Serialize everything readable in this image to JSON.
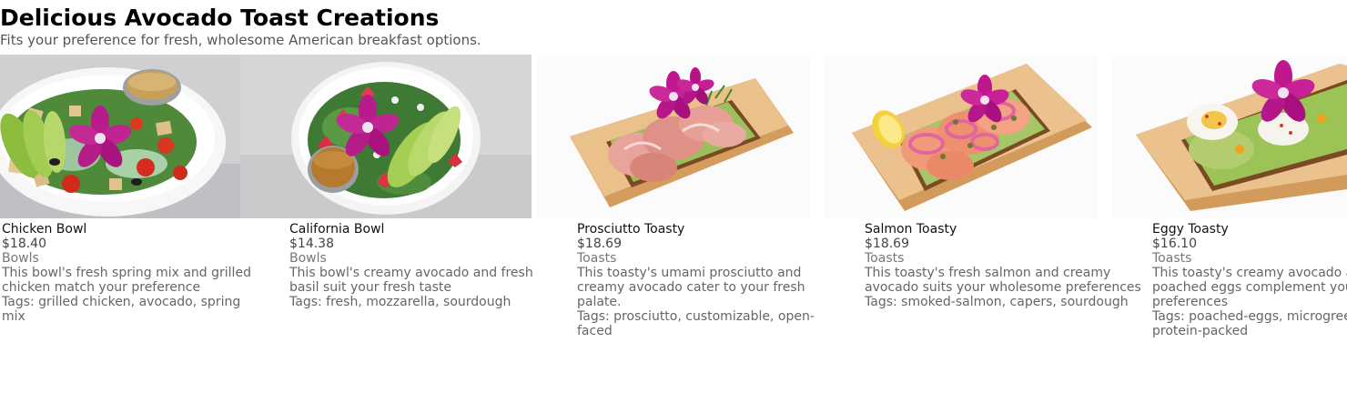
{
  "header": {
    "title": "Delicious Avocado Toast Creations",
    "subtitle": "Fits your preference for fresh, wholesome American breakfast options."
  },
  "items": [
    {
      "name": "Chicken Bowl",
      "price": "$18.40",
      "category": "Bowls",
      "description": "This bowl's fresh spring mix and grilled chicken match your preference",
      "tags": "Tags: grilled chicken, avocado, spring mix",
      "image": "salad-bowl-chicken-avocado-orchid"
    },
    {
      "name": "California Bowl",
      "price": "$14.38",
      "category": "Bowls",
      "description": "This bowl's creamy avocado and fresh basil suit your fresh taste",
      "tags": "Tags: fresh, mozzarella, sourdough",
      "image": "salad-bowl-strawberry-avocado-orchid"
    },
    {
      "name": "Prosciutto Toasty",
      "price": "$18.69",
      "category": "Toasts",
      "description": "This toasty's umami prosciutto and creamy avocado cater to your fresh palate.",
      "tags": "Tags: prosciutto, customizable, open-faced",
      "image": "prosciutto-toast-on-board"
    },
    {
      "name": "Salmon Toasty",
      "price": "$18.69",
      "category": "Toasts",
      "description": "This toasty's fresh salmon and creamy avocado suits your wholesome preferences",
      "tags": "Tags: smoked-salmon, capers, sourdough",
      "image": "salmon-toast-on-board"
    },
    {
      "name": "Eggy Toasty",
      "price": "$16.10",
      "category": "Toasts",
      "description": "This toasty's creamy avocado and poached eggs complement your fresh preferences",
      "tags": "Tags: poached-eggs, microgreens, protein-packed",
      "image": "egg-toast-on-board"
    }
  ],
  "colors": {
    "title": "#000000",
    "subtitle": "#555555",
    "muted": "#666666",
    "orchid": "#b0127e",
    "board": "#e9c08c",
    "avocado": "#9ccb4e"
  }
}
